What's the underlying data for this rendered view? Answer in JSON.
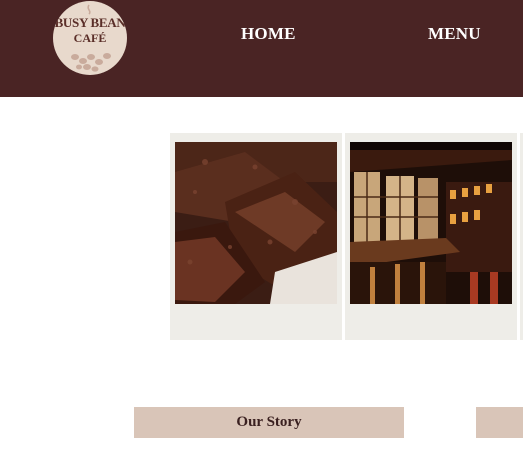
{
  "header": {
    "logo": {
      "line1": "BUSY BEAN",
      "line2": "CAFÉ"
    },
    "nav": [
      {
        "label": "HOME"
      },
      {
        "label": "MENU"
      }
    ]
  },
  "gallery": {
    "items": [
      {
        "image": "brownie-photo"
      },
      {
        "image": "cafe-interior-photo"
      }
    ]
  },
  "sections": {
    "our_story_label": "Our Story"
  },
  "colors": {
    "header_bg": "#4a2424",
    "logo_bg": "#e8d9cc",
    "card_bg": "#eeede8",
    "section_bar_bg": "#d9c5b8"
  }
}
